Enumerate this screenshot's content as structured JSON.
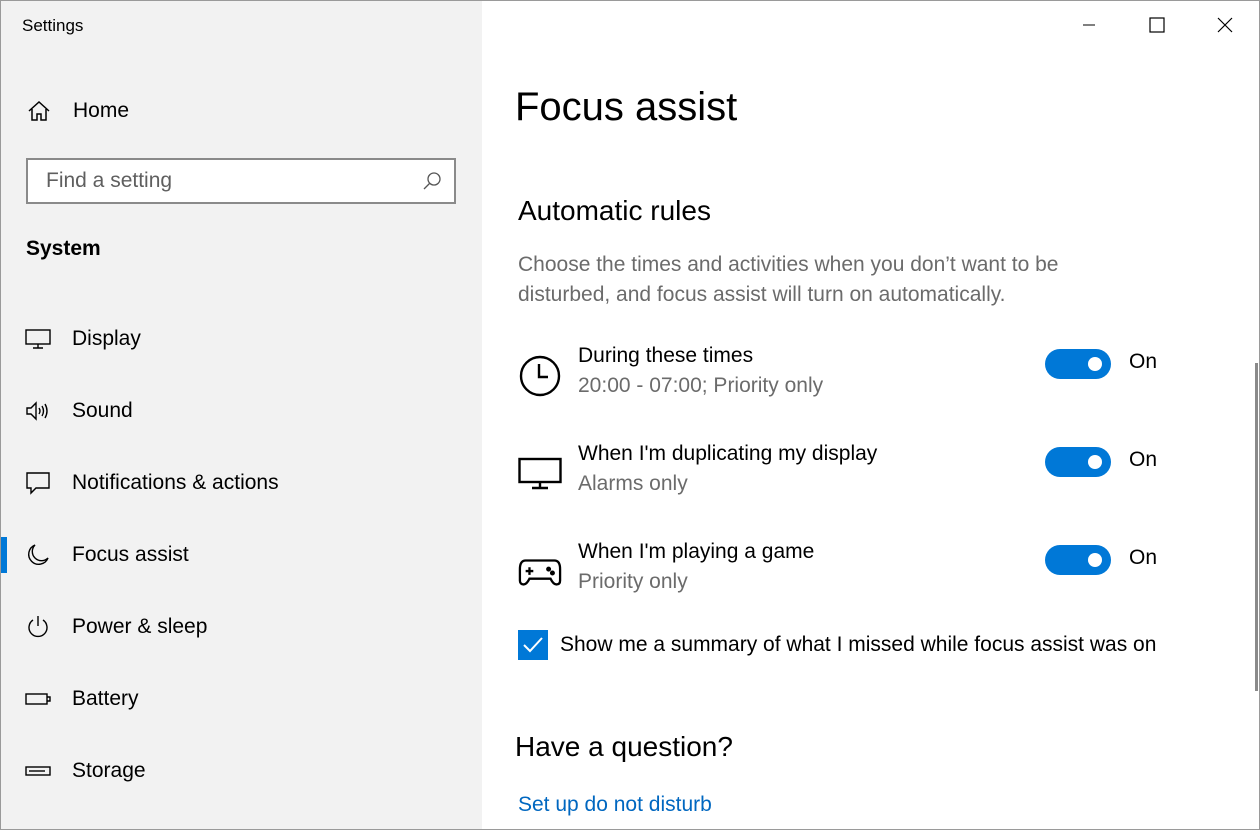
{
  "window": {
    "title": "Settings"
  },
  "sidebar": {
    "home_label": "Home",
    "search_placeholder": "Find a setting",
    "section_label": "System",
    "items": [
      {
        "label": "Display",
        "icon": "monitor-icon"
      },
      {
        "label": "Sound",
        "icon": "speaker-icon"
      },
      {
        "label": "Notifications & actions",
        "icon": "notification-icon"
      },
      {
        "label": "Focus assist",
        "icon": "moon-icon",
        "selected": true
      },
      {
        "label": "Power & sleep",
        "icon": "power-icon"
      },
      {
        "label": "Battery",
        "icon": "battery-icon"
      },
      {
        "label": "Storage",
        "icon": "storage-icon"
      }
    ]
  },
  "content": {
    "page_title": "Focus assist",
    "automatic_rules": {
      "heading": "Automatic rules",
      "description": "Choose the times and activities when you don’t want to be disturbed, and focus assist will turn on automatically.",
      "rules": [
        {
          "title": "During these times",
          "subtitle": "20:00 - 07:00; Priority only",
          "state": "On",
          "icon": "clock-icon"
        },
        {
          "title": "When I'm duplicating my display",
          "subtitle": "Alarms only",
          "state": "On",
          "icon": "monitor-icon"
        },
        {
          "title": "When I'm playing a game",
          "subtitle": "Priority only",
          "state": "On",
          "icon": "gamepad-icon"
        }
      ],
      "summary_checkbox_label": "Show me a summary of what I missed while focus assist was on"
    },
    "question": {
      "heading": "Have a question?",
      "link": "Set up do not disturb"
    }
  },
  "colors": {
    "accent": "#0078d7",
    "sidebar_bg": "#f2f2f2",
    "secondary_text": "#6b6b6b",
    "link": "#0067c0"
  }
}
